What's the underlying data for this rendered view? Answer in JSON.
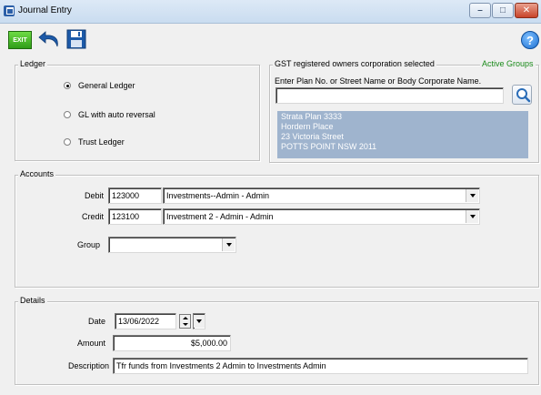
{
  "window": {
    "title": "Journal Entry",
    "controls": {
      "minimize": "–",
      "maximize": "□",
      "close": "✕"
    }
  },
  "toolbar": {
    "exit_label": "EXIT",
    "help_label": "?"
  },
  "ledger": {
    "group_label": "Ledger",
    "options": [
      {
        "label": "General Ledger",
        "selected": true
      },
      {
        "label": "GL with auto reversal",
        "selected": false
      },
      {
        "label": "Trust Ledger",
        "selected": false
      }
    ]
  },
  "gst": {
    "group_label": "GST registered owners corporation selected",
    "active_groups_label": "Active Groups",
    "search_prompt": "Enter Plan No. or Street Name or Body Corporate Name.",
    "search_value": "",
    "address_lines": [
      "Strata Plan 3333",
      "Hordern Place",
      "23 Victoria Street",
      "POTTS POINT  NSW  2011"
    ]
  },
  "accounts": {
    "group_label": "Accounts",
    "debit_label": "Debit",
    "debit_code": "123000",
    "debit_name": "Investments--Admin - Admin",
    "credit_label": "Credit",
    "credit_code": "123100",
    "credit_name": "Investment 2 - Admin - Admin",
    "group_field_label": "Group",
    "group_value": ""
  },
  "details": {
    "group_label": "Details",
    "date_label": "Date",
    "date_value": "13/06/2022",
    "amount_label": "Amount",
    "amount_value": "$5,000.00",
    "description_label": "Description",
    "description_value": "Tfr funds from Investments 2 Admin  to Investments Admin"
  },
  "colors": {
    "active_groups": "#1a8a1a",
    "address_bg": "#9fb4ce",
    "exit_green": "#2f9d18",
    "toolbar_blue": "#1d5aa8"
  }
}
